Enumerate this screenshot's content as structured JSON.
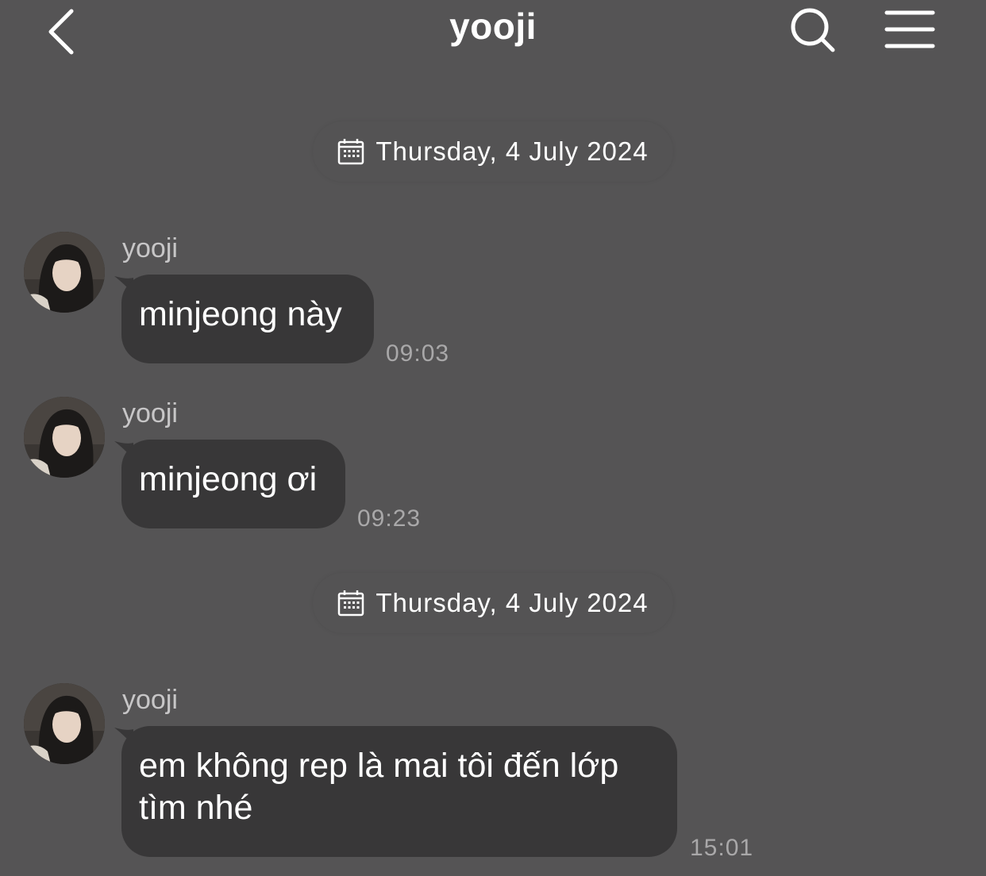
{
  "header": {
    "title": "yooji",
    "back_icon": "chevron-left-icon",
    "search_icon": "search-icon",
    "menu_icon": "menu-icon"
  },
  "dates": [
    {
      "label": "Thursday, 4 July 2024",
      "icon": "calendar-icon"
    },
    {
      "label": "Thursday, 4 July 2024",
      "icon": "calendar-icon"
    }
  ],
  "messages": [
    {
      "sender": "yooji",
      "text": "minjeong này",
      "time": "09:03"
    },
    {
      "sender": "yooji",
      "text": "minjeong ơi",
      "time": "09:23"
    },
    {
      "sender": "yooji",
      "text": "em không rep là mai tôi đến lớp tìm nhé",
      "time": "15:01"
    }
  ],
  "colors": {
    "background": "#555455",
    "bubble": "#383738",
    "text": "#ffffff",
    "muted": "#a9a8a9"
  }
}
